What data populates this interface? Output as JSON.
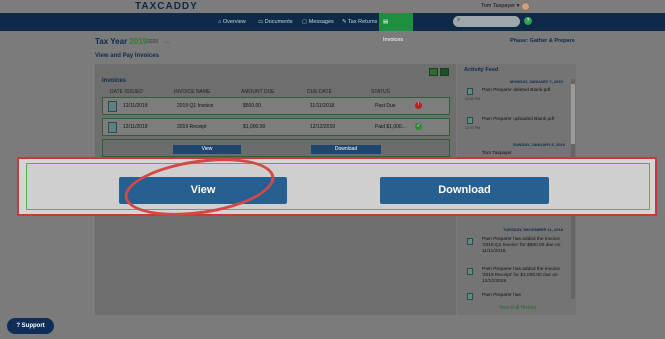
{
  "app": {
    "logo": "TAXCADDY"
  },
  "user": {
    "name": "Tom Taxpayer"
  },
  "nav": {
    "items": [
      {
        "label": "Overview"
      },
      {
        "label": "Documents"
      },
      {
        "label": "Messages"
      },
      {
        "label": "Tax Returns"
      },
      {
        "label": "Invoices"
      }
    ]
  },
  "search": {
    "placeholder": ""
  },
  "header": {
    "title_prefix": "Tax Year",
    "title_year": "2019",
    "alt_year": "2020",
    "more": "...",
    "phase": "Phase: Gather & Prepare"
  },
  "section": {
    "title": "View and Pay Invoices"
  },
  "invoices": {
    "heading": "Invoices",
    "columns": [
      "DATE ISSUED",
      "INVOICE NAME",
      "AMOUNT DUE",
      "DUE DATE",
      "STATUS"
    ],
    "rows": [
      {
        "date": "12/11/2018",
        "name": "2019 Q1 Invoice",
        "amount": "$500.00",
        "due": "11/11/2018",
        "status": "Past Due"
      },
      {
        "date": "12/11/2018",
        "name": "2019 Receipt",
        "amount": "$1,000.00",
        "due": "12/12/2019",
        "status": "Paid $1,000..."
      }
    ],
    "view_label": "View",
    "download_label": "Download"
  },
  "activity": {
    "title": "Activity Feed",
    "date1": "MONDAY, JANUARY 7, 2019",
    "item1": "Pam Preparer deleted Blank.pdf",
    "item2": "Pam Preparer uploaded Blank.pdf",
    "date2": "SUNDAY, JANUARY 6, 2019",
    "item3_name": "Tom Taxpayer",
    "date3": "TUESDAY, DECEMBER 11, 2018",
    "item4": "Pam Preparer has added the invoice '2019 Q1 Invoice' for $500.00 due on 11/11/2018.",
    "item5": "Pam Preparer has added the invoice '2019 Receipt' for $1,000.00 due on 12/12/2019.",
    "item6": "Pam Preparer has",
    "time_a": "12:09 PM",
    "time_b": "12:07 PM",
    "full_history": "View Full History"
  },
  "zoom": {
    "view_label": "View",
    "download_label": "Download"
  },
  "support": {
    "label": "Support"
  },
  "help": {
    "label": "?"
  }
}
